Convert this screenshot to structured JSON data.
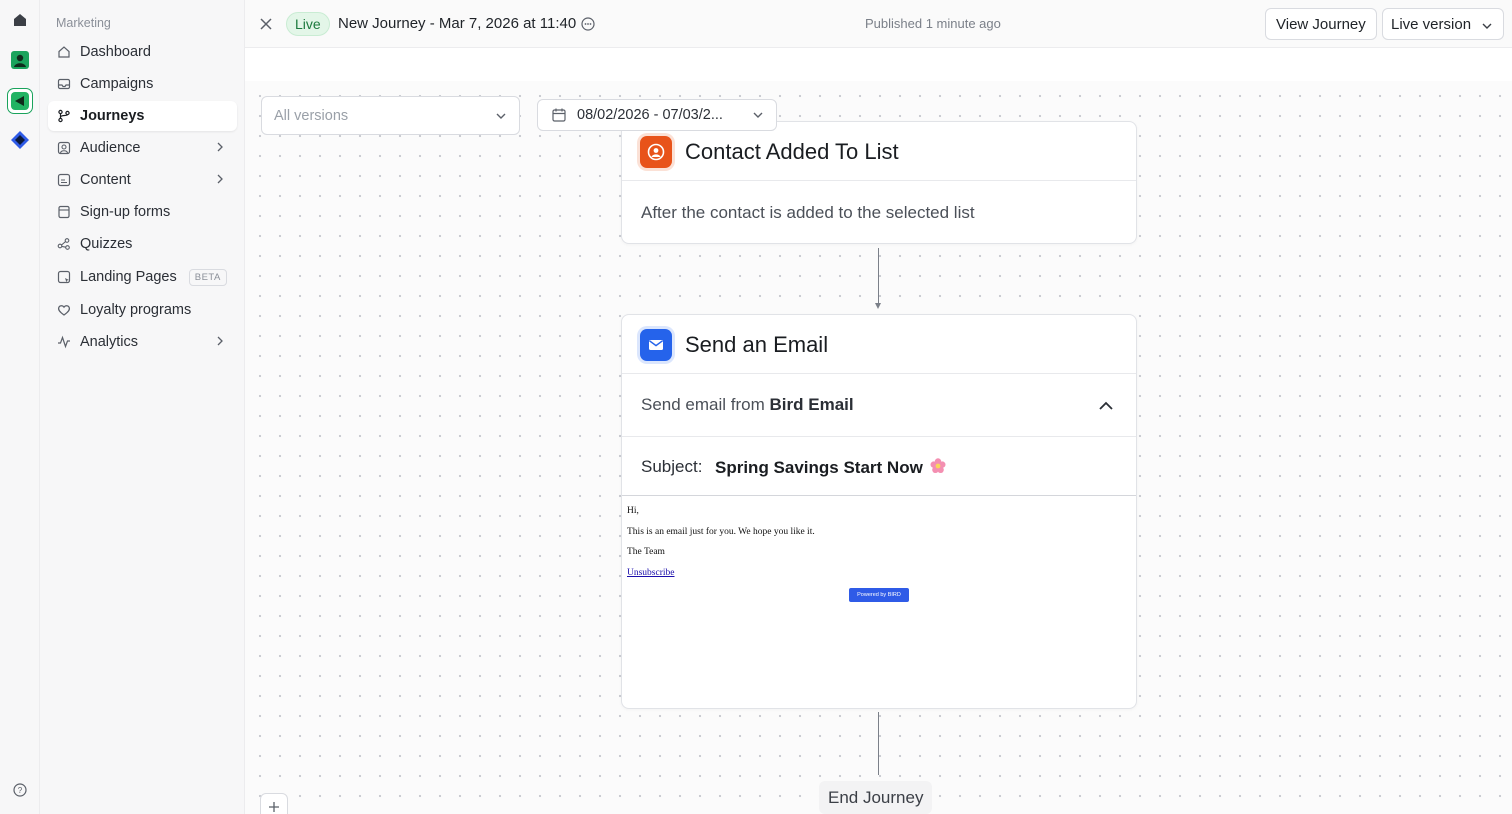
{
  "sidebar": {
    "section_label": "Marketing",
    "items": [
      {
        "label": "Dashboard"
      },
      {
        "label": "Campaigns"
      },
      {
        "label": "Journeys"
      },
      {
        "label": "Audience"
      },
      {
        "label": "Content"
      },
      {
        "label": "Sign-up forms"
      },
      {
        "label": "Quizzes"
      },
      {
        "label": "Landing Pages",
        "badge": "BETA"
      },
      {
        "label": "Loyalty programs"
      },
      {
        "label": "Analytics"
      }
    ],
    "active_item": "Journeys"
  },
  "header": {
    "status_badge": "Live",
    "journey_title": "New Journey - Mar 7, 2026 at 11:40",
    "published_text": "Published 1 minute ago",
    "view_button": "View Journey",
    "version_select": "Live version"
  },
  "filters": {
    "versions_placeholder": "All versions",
    "date_range": "08/02/2026 - 07/03/2..."
  },
  "nodes": {
    "trigger": {
      "title": "Contact Added To List",
      "description": "After the contact is added to the selected list"
    },
    "email": {
      "title": "Send an Email",
      "from_prefix": "Send email from",
      "from_sender": "Bird Email",
      "subject_label": "Subject:",
      "subject_value": "Spring Savings Start Now",
      "preview": {
        "greeting": "Hi,",
        "body": "This is an email just for you. We hope you like it.",
        "signature": "The Team",
        "unsubscribe": "Unsubscribe",
        "powered_by": "Powered by BIRD"
      }
    },
    "end": {
      "label": "End Journey"
    }
  },
  "colors": {
    "live_green": "#1d7a3e",
    "trigger_orange": "#e8531a",
    "email_blue": "#2563eb",
    "brand_green": "#1aa35c"
  }
}
